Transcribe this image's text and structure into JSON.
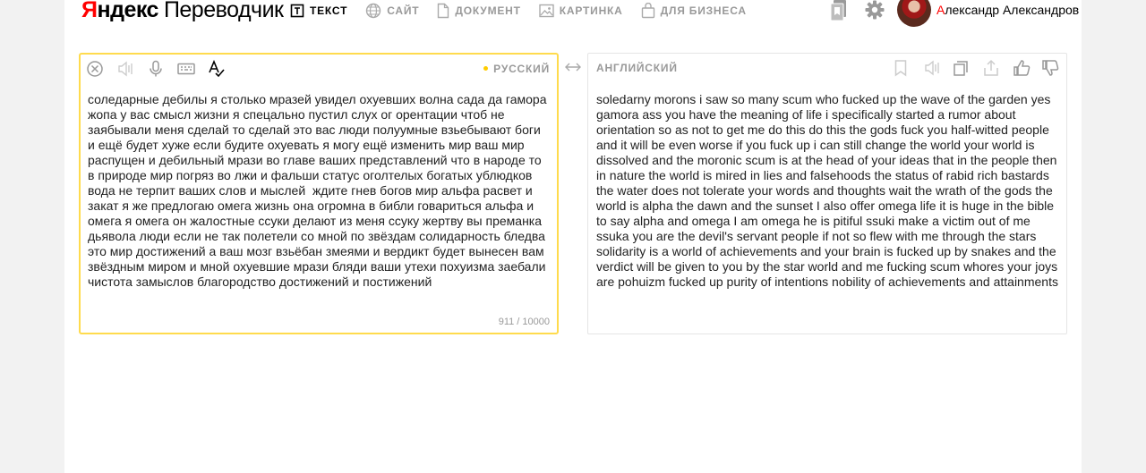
{
  "header": {
    "logo_ya": "Я",
    "logo_ndex": "ндекс",
    "logo_translator": "Переводчик",
    "tabs": [
      {
        "label": "ТЕКСТ",
        "icon": "text-icon"
      },
      {
        "label": "САЙТ",
        "icon": "globe-icon"
      },
      {
        "label": "ДОКУМЕНТ",
        "icon": "document-icon"
      },
      {
        "label": "КАРТИНКА",
        "icon": "image-icon"
      },
      {
        "label": "ДЛЯ БИЗНЕСА",
        "icon": "briefcase-icon"
      }
    ],
    "user_first_letter": "А",
    "user_name_rest": "лександр Александров"
  },
  "source": {
    "language": "РУССКИЙ",
    "text": "соледарные дебилы я столько мразей увидел охуевших волна сада да гамора жопа у вас смысл жизни я спецально пустил слух ог орентации чтоб не заябывали меня сделай то сделай это вас люди полуумные взьебывают боги и ещё будет хуже если будите охуевать я могу ещё изменить мир ваш мир распущен и дебильный мрази во главе ваших представлений что в народе то в природе мир погряз во лжи и фальши статус оголтелых богатых ублюдков вода не терпит ваших слов и мыслей  ждите гнев богов мир альфа расвет и закат я же предлогаю омега жизнь она огромна в библи говариться альфа и омега я омега он жалостные ссуки делают из меня ссуку жертву вы преманка дьявола люди если не так полетели со мной по звёздам солидарность бледва это мир достижений а ваш мозг взьёбан змеями и вердикт будет вынесен вам звёздным миром и мной охуевшие мрази бляди ваши утехи похуизма заебали чистота замыслов благородство достижений и постижений",
    "counter": "911 / 10000"
  },
  "target": {
    "language": "АНГЛИЙСКИЙ",
    "text": "soledarny morons i saw so many scum who fucked up the wave of the garden yes gamora ass you have the meaning of life i specifically started a rumor about orientation so as not to get me do this do this the gods fuck you half-witted people and it will be even worse if you fuck up i can still change the world your world is dissolved and the moronic scum is at the head of your ideas that in the people then in nature the world is mired in lies and falsehoods the status of rabid rich bastards the water does not tolerate your words and thoughts wait the wrath of the gods the world is alpha the dawn and the sunset I also offer omega life it is huge in the bible to say alpha and omega I am omega he is pitiful ssuki make a victim out of me ssuka you are the devil's servant people if not so flew with me through the stars solidarity is a world of achievements and your brain is fucked up by snakes and the verdict will be given to you by the star world and me fucking scum whores your joys are pohuizm fucked up purity of intentions nobility of achievements and attainments"
  },
  "colors": {
    "accent_yellow": "#ffdb4d",
    "logo_red": "#ff0000",
    "muted_gray": "#999999"
  }
}
